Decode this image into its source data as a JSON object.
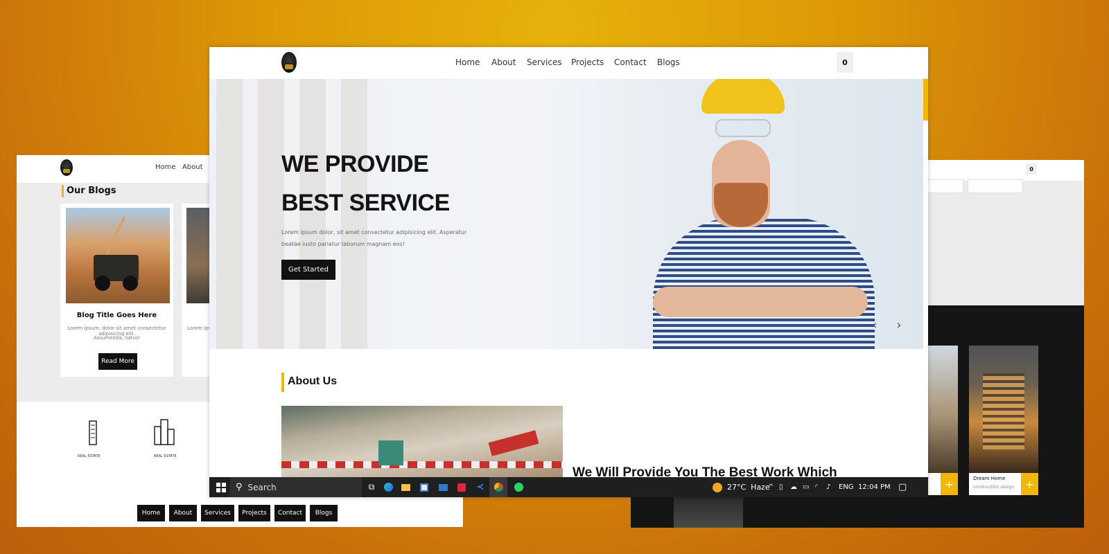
{
  "colors": {
    "accent": "#f2b705",
    "dark": "#111111",
    "background": "#dd9a06"
  },
  "main": {
    "logo": "logo",
    "nav": [
      "Home",
      "About",
      "Services",
      "Projects",
      "Contact",
      "Blogs"
    ],
    "cart_count": "0",
    "hero": {
      "title_line1": "WE PROVIDE",
      "title_line2": "BEST SERVICE",
      "text_line1": "Lorem ipsum dolor, sit amet consectetur adipisicing elit. Asperatur",
      "text_line2": "beatae iusto pariatur laborum magnam eos!",
      "cta": "Get Started",
      "prev_icon": "chevron-left-icon",
      "next_icon": "chevron-right-icon"
    },
    "about": {
      "title": "About Us",
      "heading": "We Will Provide You The Best Work Which"
    }
  },
  "taskbar": {
    "search": "Search",
    "weather": "27°C  Haze",
    "language": "ENG",
    "time": "12:04 PM"
  },
  "left": {
    "nav": [
      "Home",
      "About"
    ],
    "section_title": "Our Blogs",
    "blog": {
      "title": "Blog Title Goes Here",
      "text_line1": "Lorem ipsum, dolor sit amet consectetur adipisicing elit.",
      "text_line2": "Assumenda, natus!",
      "button": "Read More",
      "text_partial": "Lorem ipsu"
    },
    "partners": [
      {
        "name": "REAL ESTATE"
      },
      {
        "name": "REAL ESTATE"
      }
    ],
    "footer_nav": [
      "Home",
      "About",
      "Services",
      "Projects",
      "Contact",
      "Blogs"
    ]
  },
  "right": {
    "cart_count": "0",
    "projects": [
      {
        "title": "",
        "subtitle": "sign"
      },
      {
        "title": "Dream Home",
        "subtitle": "construction design"
      }
    ],
    "plus": "+"
  }
}
